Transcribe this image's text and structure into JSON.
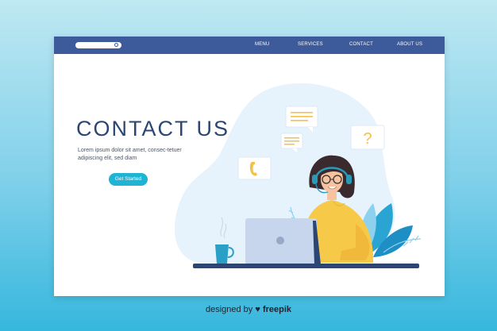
{
  "nav": {
    "items": [
      {
        "label": "MENU"
      },
      {
        "label": "SERVICES"
      },
      {
        "label": "CONTACT"
      },
      {
        "label": "ABOUT US"
      }
    ]
  },
  "hero": {
    "title": "CONTACT US",
    "description": "Lorem ipsum dolor sit amet, consec-tetuer adipiscing elit, sed diam",
    "button_label": "Get Started"
  },
  "illustration": {
    "question_mark": "?"
  },
  "footer": {
    "prefix": "designed by",
    "brand": "freepik"
  },
  "colors": {
    "nav_bg": "#3d5a9a",
    "title": "#2c4673",
    "accent": "#1fb3d4",
    "blob": "#e4f1fb"
  }
}
